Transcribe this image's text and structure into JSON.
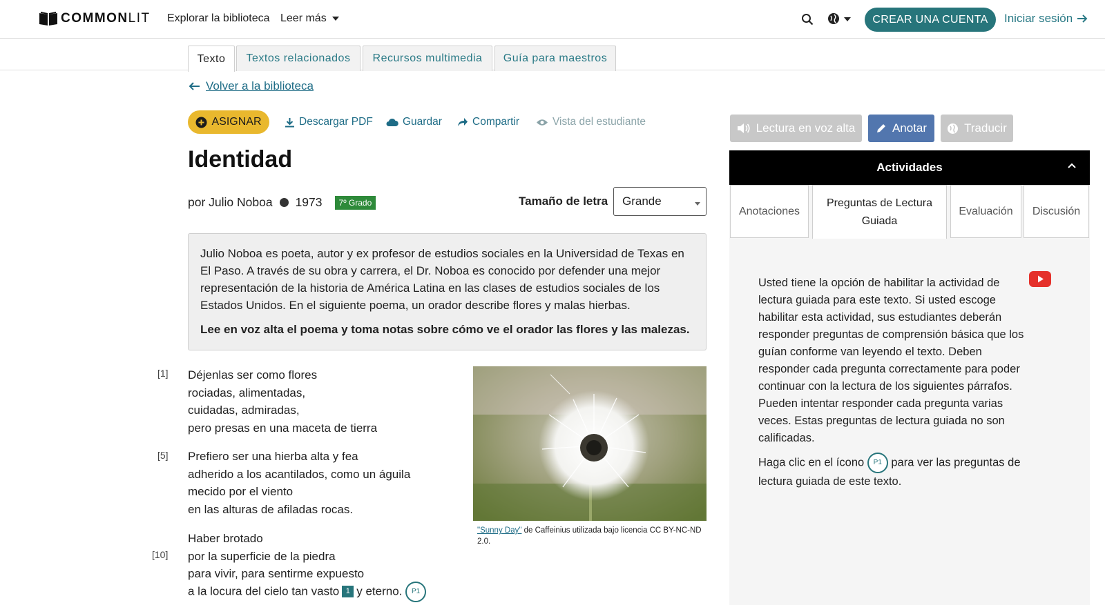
{
  "nav": {
    "logo_common": "COMMON",
    "logo_lit": "LIT",
    "explore": "Explorar la biblioteca",
    "read_more": "Leer más",
    "create_account": "CREAR UNA CUENTA",
    "login": "Iniciar sesión"
  },
  "tabs": [
    "Texto",
    "Textos relacionados",
    "Recursos multimedia",
    "Guía para maestros"
  ],
  "back_link": "Volver a la biblioteca",
  "actions": {
    "assign": "ASIGNAR",
    "download": "Descargar PDF",
    "save": "Guardar",
    "share": "Compartir",
    "student_view": "Vista del estudiante"
  },
  "text": {
    "title": "Identidad",
    "author": "por Julio Noboa",
    "year": "1973",
    "grade": "7º Grado",
    "font_size_label": "Tamaño de letra",
    "font_size_value": "Grande",
    "intro": "Julio Noboa es poeta, autor y ex profesor de estudios sociales en la Universidad de Texas en El Paso. A través de su obra y carrera, el Dr. Noboa es conocido por defender una mejor representación de la historia de América Latina en las clases de estudios sociales de los Estados Unidos. En el siguiente poema, un orador describe flores y malas hierbas.",
    "intro_bold": "Lee en voz alta el poema y toma notas sobre cómo ve el orador las flores y las malezas."
  },
  "poem": {
    "line_numbers": [
      "[1]",
      "[5]",
      "[10]"
    ],
    "stanza1": [
      "Déjenlas ser como flores",
      "rociadas, alimentadas,",
      "cuidadas, admiradas,",
      "pero presas en una maceta de tierra"
    ],
    "stanza2": [
      "Prefiero ser una hierba alta y fea",
      "adherido a los acantilados, como un águila",
      "mecido por el viento",
      "en las alturas de afiladas rocas."
    ],
    "stanza3": [
      "Haber brotado",
      "por la superficie de la piedra",
      "para vivir, para sentirme expuesto"
    ],
    "last_line_a": "a la locura del cielo tan vasto",
    "footnote": "1",
    "last_line_b": "y eterno.",
    "badge": "P1"
  },
  "image": {
    "caption_link": "\"Sunny Day\"",
    "caption_rest": " de Caffeinius utilizada bajo licencia CC BY-NC-ND 2.0."
  },
  "tools": {
    "read_aloud": "Lectura en voz alta",
    "annotate": "Anotar",
    "translate": "Traducir"
  },
  "activities": {
    "header": "Actividades",
    "tabs": [
      "Anotaciones",
      "Preguntas de Lectura Guiada",
      "Evaluación",
      "Discusión"
    ],
    "body_1": "Usted tiene la opción de habilitar la actividad de lectura guiada para este texto. Si usted escoge habilitar esta actividad, sus estudiantes deberán responder preguntas de comprensión básica que los guían conforme van leyendo el texto. Deben responder cada pregunta correctamente para poder continuar con la lectura de los siguientes párrafos. Pueden intentar responder cada pregunta varias veces. Estas preguntas de lectura guiada no son calificadas.",
    "body_2a": "Haga clic en el ícono",
    "body_2_badge": "P1",
    "body_2b": "para ver las preguntas de lectura guiada de este texto."
  },
  "colors": {
    "teal": "#27757b",
    "link": "#1e6c86",
    "assign_yellow": "#e9b82e",
    "grade_green": "#2e8a3a",
    "annotate_blue": "#5276ae"
  }
}
